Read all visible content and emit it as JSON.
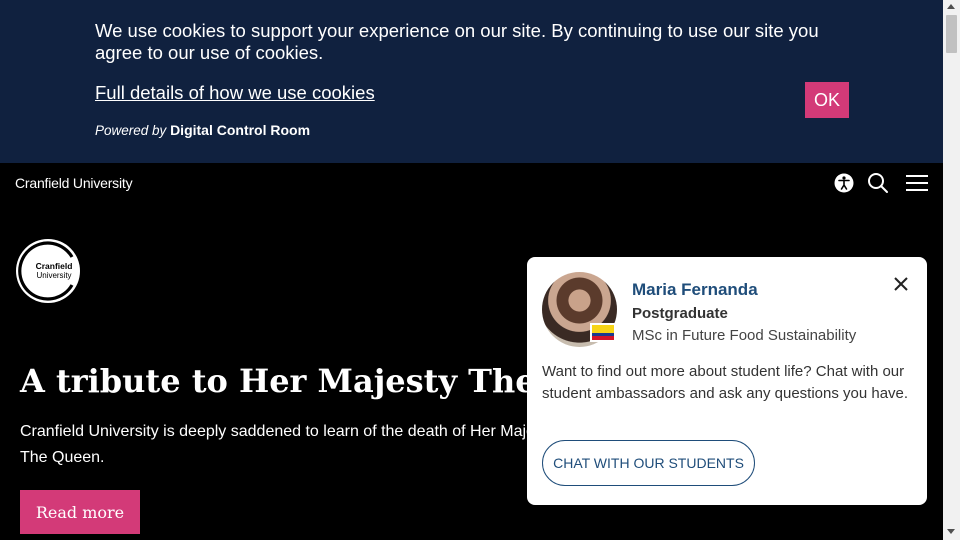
{
  "cookie_banner": {
    "message": "We use cookies to support your experience on our site. By continuing to use our site you agree to our use of cookies.",
    "details_link": "Full details of how we use cookies",
    "ok_label": "OK",
    "powered_by_prefix": "Powered by",
    "powered_by_name": "Digital Control Room"
  },
  "header": {
    "site_name": "Cranfield University",
    "icons": [
      "accessibility-icon",
      "search-icon",
      "menu-icon"
    ]
  },
  "logo": {
    "line1": "Cranfield",
    "line2": "University"
  },
  "hero": {
    "title": "A tribute to Her Majesty The Queen",
    "text": "Cranfield University is deeply saddened to learn of the death of Her Majesty The Queen.",
    "button_label": "Read more"
  },
  "chat_widget": {
    "name": "Maria Fernanda",
    "level": "Postgraduate",
    "course": "MSc in Future Food Sustainability",
    "message": "Want to find out more about student life? Chat with our student ambassadors and ask any questions you have.",
    "button_label": "CHAT WITH OUR STUDENTS"
  },
  "colors": {
    "banner_bg": "#10213f",
    "accent_pink": "#d33a78",
    "page_bg": "#000000",
    "chat_blue": "#1f4d7a"
  }
}
